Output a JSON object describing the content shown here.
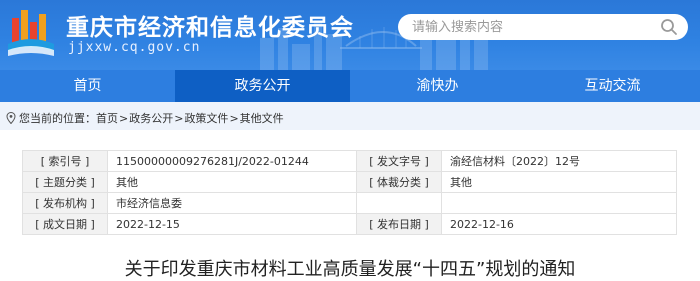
{
  "header": {
    "title": "重庆市经济和信息化委员会",
    "domain": "jjxxw.cq.gov.cn",
    "search_placeholder": "请输入搜索内容"
  },
  "colors": {
    "header_blue": "#2f82e2",
    "nav_active": "#0e5fc4",
    "breadcrumb_bg": "#eef3fb"
  },
  "nav": {
    "items": [
      {
        "label": "首页"
      },
      {
        "label": "政务公开"
      },
      {
        "label": "渝快办"
      },
      {
        "label": "互动交流"
      }
    ],
    "active_index": 1
  },
  "breadcrumb": {
    "prefix": "您当前的位置：",
    "items": [
      "首页",
      "政务公开",
      "政策文件",
      "其他文件"
    ],
    "separator": ">"
  },
  "info": {
    "rows": [
      {
        "label1": "[ 索引号 ]",
        "value1": "11500000009276281J/2022-01244",
        "label2": "[ 发文字号 ]",
        "value2": "渝经信材料〔2022〕12号"
      },
      {
        "label1": "[ 主题分类 ]",
        "value1": "其他",
        "label2": "[ 体裁分类 ]",
        "value2": "其他"
      },
      {
        "label1": "[ 发布机构 ]",
        "value1": "市经济信息委",
        "label2": "",
        "value2": ""
      },
      {
        "label1": "[ 成文日期 ]",
        "value1": "2022-12-15",
        "label2": "[ 发布日期 ]",
        "value2": "2022-12-16"
      }
    ]
  },
  "document": {
    "title": "关于印发重庆市材料工业高质量发展“十四五”规划的通知"
  }
}
